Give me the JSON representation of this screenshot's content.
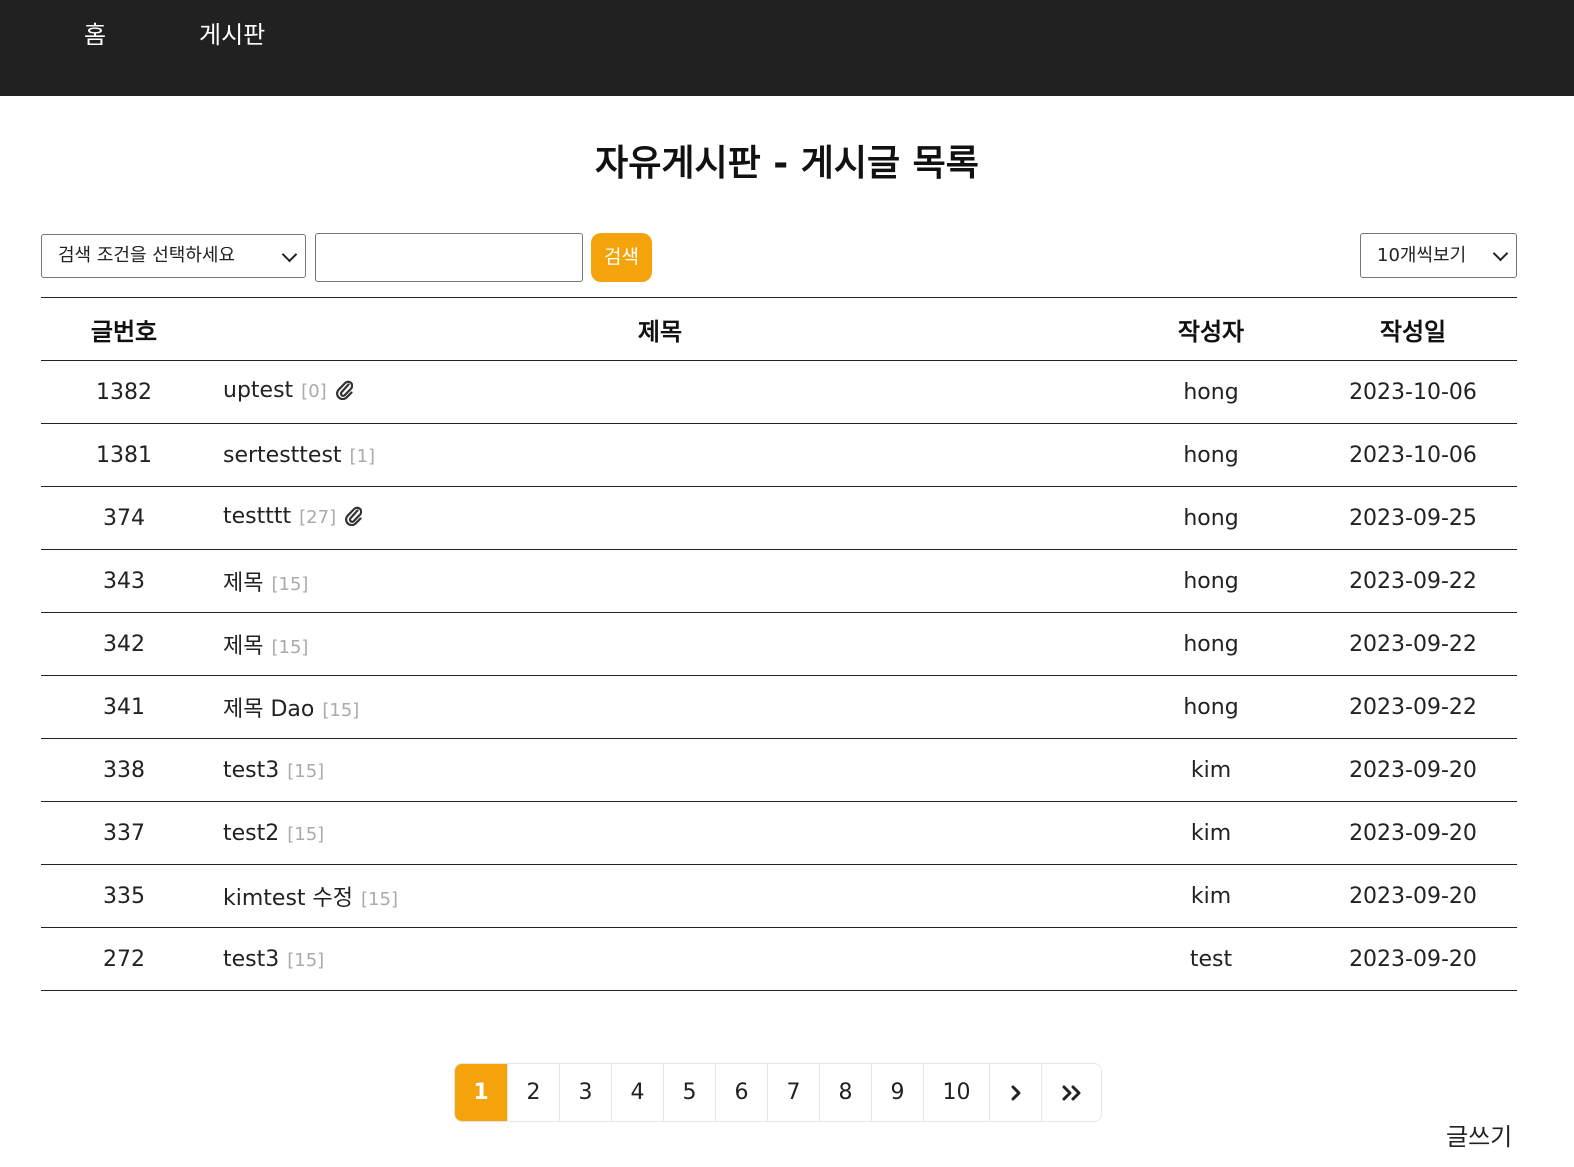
{
  "nav": {
    "home": "홈",
    "board": "게시판"
  },
  "page_title": "자유게시판 - 게시글 목록",
  "search": {
    "condition_selected": "검색 조건을 선택하세요",
    "input_value": "",
    "button_label": "검색",
    "per_page_selected": "10개씩보기"
  },
  "table": {
    "headers": {
      "num": "글번호",
      "title": "제목",
      "writer": "작성자",
      "date": "작성일"
    },
    "rows": [
      {
        "num": "1382",
        "title": "uptest",
        "count": "[0]",
        "attachment": true,
        "writer": "hong",
        "date": "2023-10-06"
      },
      {
        "num": "1381",
        "title": "sertesttest",
        "count": "[1]",
        "attachment": false,
        "writer": "hong",
        "date": "2023-10-06"
      },
      {
        "num": "374",
        "title": "testttt",
        "count": "[27]",
        "attachment": true,
        "writer": "hong",
        "date": "2023-09-25"
      },
      {
        "num": "343",
        "title": "제목",
        "count": "[15]",
        "attachment": false,
        "writer": "hong",
        "date": "2023-09-22"
      },
      {
        "num": "342",
        "title": "제목",
        "count": "[15]",
        "attachment": false,
        "writer": "hong",
        "date": "2023-09-22"
      },
      {
        "num": "341",
        "title": "제목 Dao",
        "count": "[15]",
        "attachment": false,
        "writer": "hong",
        "date": "2023-09-22"
      },
      {
        "num": "338",
        "title": "test3",
        "count": "[15]",
        "attachment": false,
        "writer": "kim",
        "date": "2023-09-20"
      },
      {
        "num": "337",
        "title": "test2",
        "count": "[15]",
        "attachment": false,
        "writer": "kim",
        "date": "2023-09-20"
      },
      {
        "num": "335",
        "title": "kimtest 수정",
        "count": "[15]",
        "attachment": false,
        "writer": "kim",
        "date": "2023-09-20"
      },
      {
        "num": "272",
        "title": "test3",
        "count": "[15]",
        "attachment": false,
        "writer": "test",
        "date": "2023-09-20"
      }
    ]
  },
  "pagination": {
    "pages": [
      "1",
      "2",
      "3",
      "4",
      "5",
      "6",
      "7",
      "8",
      "9",
      "10"
    ],
    "current": "1",
    "next_icon": "chevron-right-icon",
    "last_icon": "double-chevron-right-icon",
    "accent_color": "#f5a30b"
  },
  "write_link": "글쓰기",
  "colors": {
    "nav_bg": "#212121",
    "accent": "#f5a30b"
  }
}
